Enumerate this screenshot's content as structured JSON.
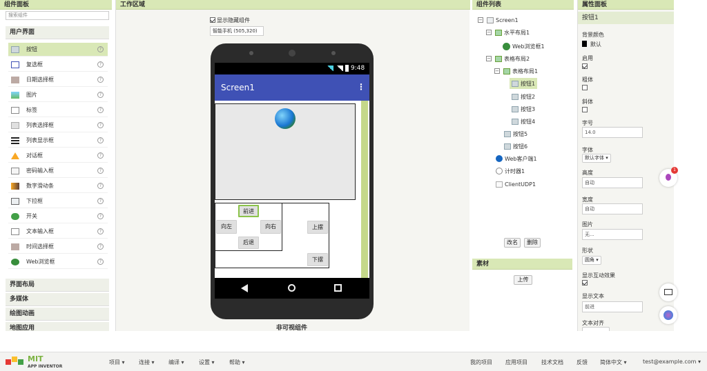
{
  "palette": {
    "header": "组件面板",
    "search_placeholder": "搜索组件",
    "category_user_interface": "用户界面",
    "items": [
      {
        "label": "按钮",
        "icon": "button-icon"
      },
      {
        "label": "复选框",
        "icon": "checkbox-icon"
      },
      {
        "label": "日期选择框",
        "icon": "datepicker-icon"
      },
      {
        "label": "图片",
        "icon": "image-icon"
      },
      {
        "label": "标签",
        "icon": "label-icon"
      },
      {
        "label": "列表选择框",
        "icon": "listpicker-icon"
      },
      {
        "label": "列表显示框",
        "icon": "listview-icon"
      },
      {
        "label": "对话框",
        "icon": "notifier-icon"
      },
      {
        "label": "密码输入框",
        "icon": "password-icon"
      },
      {
        "label": "数字滑动条",
        "icon": "slider-icon"
      },
      {
        "label": "下拉框",
        "icon": "spinner-icon"
      },
      {
        "label": "开关",
        "icon": "switch-icon"
      },
      {
        "label": "文本输入框",
        "icon": "textbox-icon"
      },
      {
        "label": "时间选择框",
        "icon": "timepicker-icon"
      },
      {
        "label": "Web浏览框",
        "icon": "webviewer-icon"
      }
    ],
    "help": "?",
    "categories_bottom": [
      "界面布局",
      "多媒体",
      "绘图动画",
      "地图应用"
    ]
  },
  "viewer": {
    "header": "工作区域",
    "show_hidden_label": "显示隐藏组件",
    "device_select": "智能手机 (505,320)",
    "status_time": "9:48",
    "screen_title": "Screen1",
    "menu_dots": "⋮",
    "buttons": {
      "forward": "前进",
      "left": "向左",
      "right": "向右",
      "back": "后退",
      "up": "上摆",
      "down": "下摆"
    },
    "nonvisible_label": "非可视组件"
  },
  "tree": {
    "header": "组件列表",
    "nodes": [
      {
        "label": "Screen1"
      },
      {
        "label": "水平布局1"
      },
      {
        "label": "Web浏览框1"
      },
      {
        "label": "表格布局2"
      },
      {
        "label": "表格布局1"
      },
      {
        "label": "按钮1"
      },
      {
        "label": "按钮2"
      },
      {
        "label": "按钮3"
      },
      {
        "label": "按钮4"
      },
      {
        "label": "按钮5"
      },
      {
        "label": "按钮6"
      },
      {
        "label": "Web客户端1"
      },
      {
        "label": "计时器1"
      },
      {
        "label": "ClientUDP1"
      }
    ],
    "rename": "改名",
    "delete": "删除",
    "media_header": "素材",
    "upload": "上传"
  },
  "props": {
    "header": "属性面板",
    "component": "按钮1",
    "bgcolor_label": "背景颜色",
    "bgcolor_value": "默认",
    "enabled_label": "启用",
    "bold_label": "粗体",
    "italic_label": "斜体",
    "fontsize_label": "字号",
    "fontsize_value": "14.0",
    "font_label": "字体",
    "font_value": "默认字体 ▾",
    "height_label": "高度",
    "height_value": "自动",
    "width_label": "宽度",
    "width_value": "自动",
    "image_label": "图片",
    "image_value": "无...",
    "shape_label": "形状",
    "shape_value": "圆角 ▾",
    "feedback_label": "显示互动效果",
    "text_label": "显示文本",
    "text_value": "前进",
    "align_label": "文本对齐"
  },
  "badge_count": "1",
  "bottom": {
    "logo_mit": "MIT",
    "logo_sub": "APP INVENTOR",
    "menu": [
      "项目 ▾",
      "连接 ▾",
      "编译 ▾",
      "设置 ▾",
      "帮助 ▾"
    ],
    "right": [
      "我的项目",
      "应用项目",
      "技术文档",
      "反馈",
      "简体中文 ▾",
      "test@example.com ▾"
    ]
  },
  "colors": {
    "header_green": "#d9e8b6",
    "appbar": "#3f51b5",
    "accent_green": "#8bc34a"
  }
}
